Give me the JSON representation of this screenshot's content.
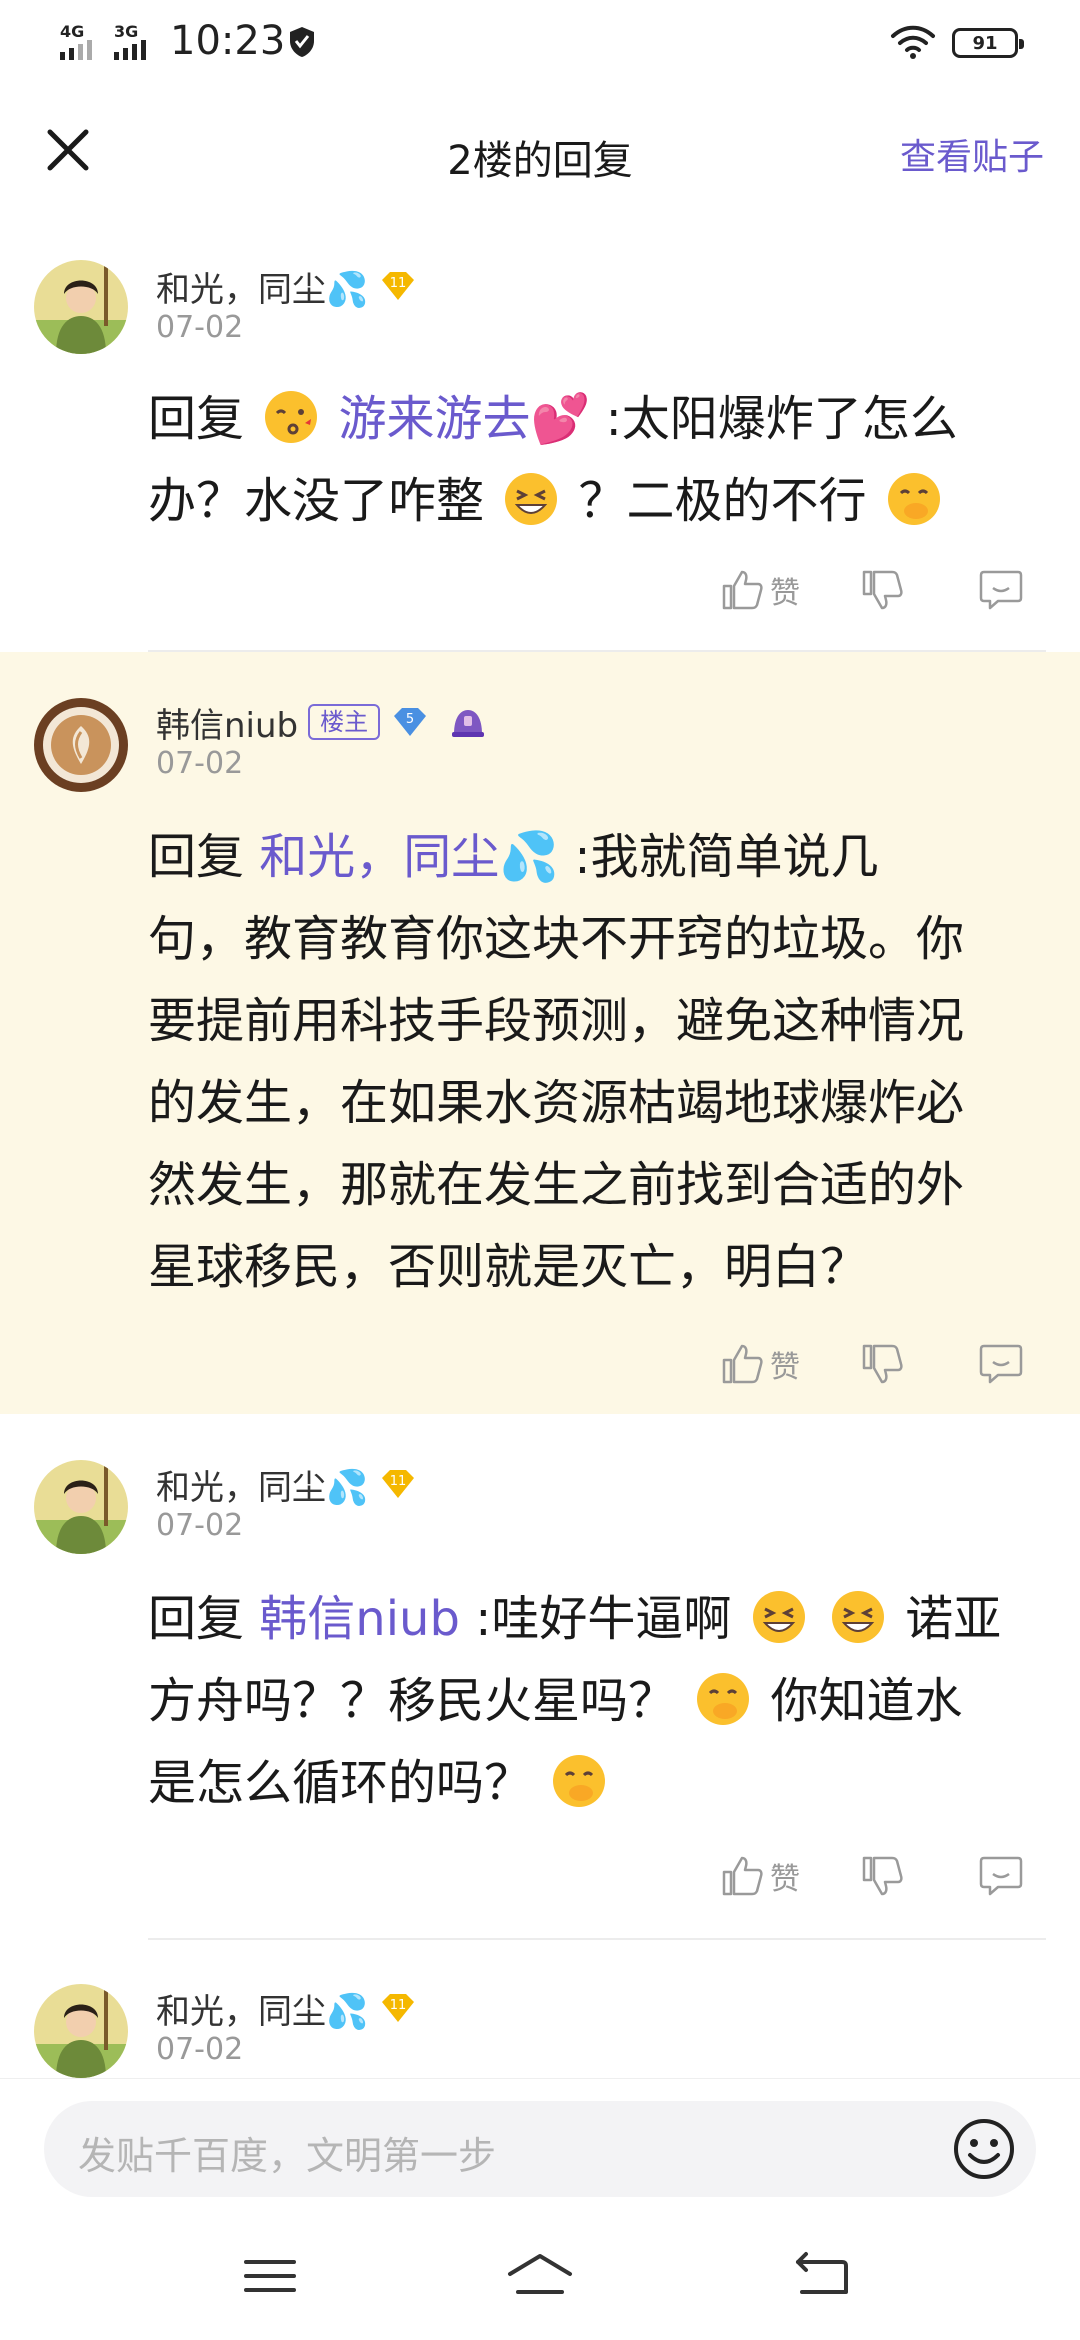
{
  "status_bar": {
    "net1": "4G",
    "net2": "3G",
    "time": "10:23",
    "battery": "91"
  },
  "header": {
    "title": "2楼的回复",
    "view_post": "查看贴子"
  },
  "replies": [
    {
      "user": "和光，同尘💦",
      "level": "11",
      "date": "07-02",
      "prefix": "回复",
      "mention": "游来游去💕",
      "lines": [
        ":太阳爆炸了怎么",
        "办？水没了咋整",
        "？二极的不行"
      ],
      "like_label": "赞"
    },
    {
      "user": "韩信niub",
      "owner_badge": "楼主",
      "level": "5",
      "date": "07-02",
      "prefix": "回复",
      "mention": "和光，同尘💦",
      "lines": [
        ":我就简单说几",
        "句，教育教育你这块不开窍的垃圾。你",
        "要提前用科技手段预测，避免这种情况",
        "的发生，在如果水资源枯竭地球爆炸必",
        "然发生，那就在发生之前找到合适的外",
        "星球移民，否则就是灭亡，明白？"
      ],
      "like_label": "赞"
    },
    {
      "user": "和光，同尘💦",
      "level": "11",
      "date": "07-02",
      "prefix": "回复",
      "mention": "韩信niub",
      "lines": [
        ":哇好牛逼啊",
        "诺亚",
        "方舟吗？？移民火星吗？",
        "你知道水",
        "是怎么循环的吗？"
      ],
      "like_label": "赞"
    },
    {
      "user": "和光，同尘💦",
      "level": "11",
      "date": "07-02"
    }
  ],
  "input": {
    "placeholder": "发贴千百度，文明第一步"
  },
  "icons": {
    "close": "close-icon",
    "like": "thumbs-up-icon",
    "dislike": "thumbs-down-icon",
    "comment": "comment-icon",
    "smile": "smile-icon",
    "menu": "menu-icon",
    "home": "home-icon",
    "back": "back-icon"
  },
  "colors": {
    "accent": "#6a5acd",
    "highlight_bg": "#fdf8e5",
    "level_gold": "#f5b800",
    "level_blue": "#4a90e2"
  }
}
